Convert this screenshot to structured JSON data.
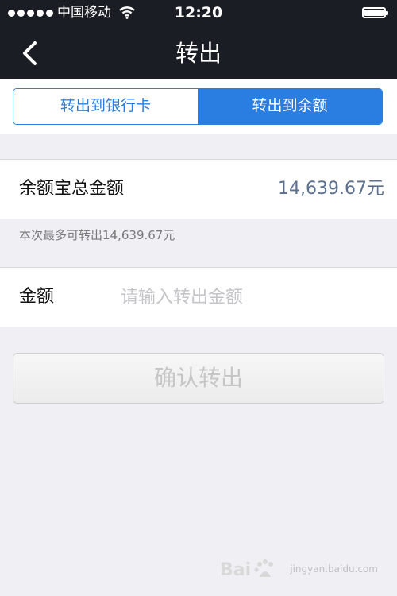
{
  "status_bar": {
    "carrier": "中国移动",
    "time": "12:20",
    "icons": [
      "signal-dots-icon",
      "wifi-icon",
      "battery-icon"
    ]
  },
  "nav": {
    "title": "转出",
    "back_icon": "chevron-left-icon"
  },
  "tabs": [
    {
      "label": "转出到银行卡",
      "selected": false
    },
    {
      "label": "转出到余额",
      "selected": true
    }
  ],
  "balance": {
    "label": "余额宝总金额",
    "value": "14,639.67元"
  },
  "hint": "本次最多可转出14,639.67元",
  "amount": {
    "label": "金额",
    "value": "",
    "placeholder": "请输入转出金额"
  },
  "confirm_button": "确认转出",
  "watermark": {
    "logo_text": "Bai度",
    "subtitle": "jingyan.baidu.com"
  },
  "colors": {
    "accent": "#2a7de1",
    "nav_background": "#1a1d23",
    "page_background": "#efeff4",
    "value_text": "#5b6f8e"
  }
}
